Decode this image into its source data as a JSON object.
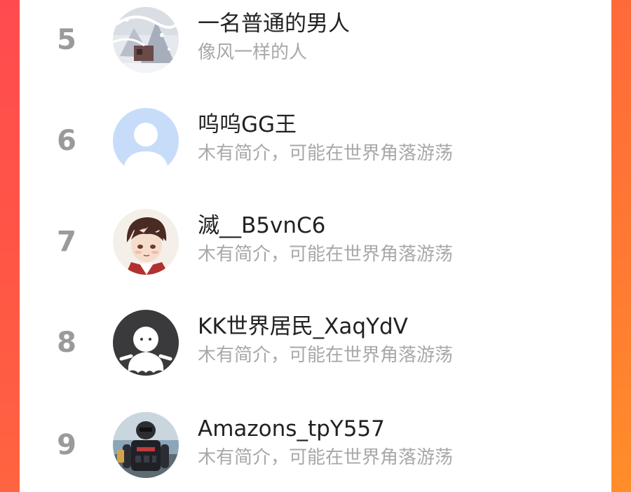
{
  "colors": {
    "background_accent": "#ff6a3e",
    "rank_text": "#9a9a9a",
    "name_text": "#222222",
    "bio_text": "#a8a8a8"
  },
  "ranking_list": {
    "items": [
      {
        "rank": "5",
        "name": "一名普通的男人",
        "bio": "像风一样的人",
        "avatar_icon": "snow-scene-avatar"
      },
      {
        "rank": "6",
        "name": "呜呜GG王",
        "bio": "木有简介，可能在世界角落游荡",
        "avatar_icon": "default-user-avatar"
      },
      {
        "rank": "7",
        "name": "滅__B5vnC6",
        "bio": "木有简介，可能在世界角落游荡",
        "avatar_icon": "anime-boy-avatar"
      },
      {
        "rank": "8",
        "name": "KK世界居民_XaqYdV",
        "bio": "木有简介，可能在世界角落游荡",
        "avatar_icon": "ghost-figure-avatar"
      },
      {
        "rank": "9",
        "name": "Amazons_tpY557",
        "bio": "木有简介，可能在世界角落游荡",
        "avatar_icon": "armored-figure-avatar"
      }
    ]
  }
}
